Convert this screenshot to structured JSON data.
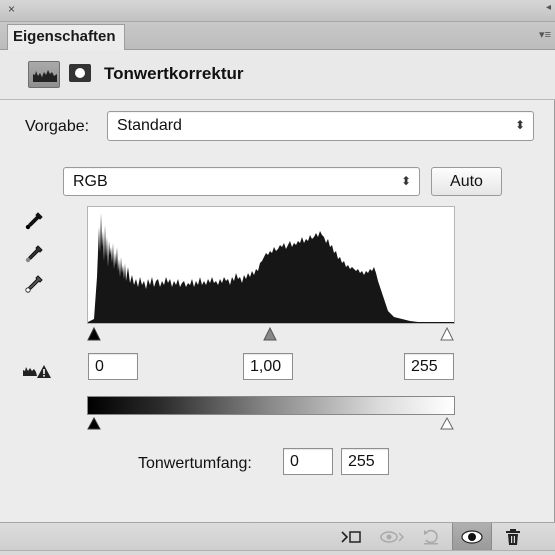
{
  "window": {
    "close_glyph": "×",
    "collapse_glyph": "◂"
  },
  "tab": {
    "label": "Eigenschaften",
    "menu_glyph": "▾≡"
  },
  "header": {
    "title": "Tonwertkorrektur",
    "adjustment_icon": "levels-histogram-icon",
    "mask_icon": "layer-mask-icon"
  },
  "preset": {
    "label": "Vorgabe:",
    "value": "Standard",
    "arrows": "⬍"
  },
  "channel": {
    "value": "RGB",
    "arrows": "⬍"
  },
  "auto_button": {
    "label": "Auto"
  },
  "eyedroppers": [
    "black-point-eyedropper-icon",
    "gray-point-eyedropper-icon",
    "white-point-eyedropper-icon"
  ],
  "input_levels": {
    "black": "0",
    "gamma": "1,00",
    "white": "255"
  },
  "output": {
    "label": "Tonwertumfang:",
    "black": "0",
    "white": "255"
  },
  "toolbar": {
    "clip_icon": "clip-to-layer-icon",
    "previous_icon": "view-previous-state-icon",
    "reset_icon": "reset-adjustments-icon",
    "visibility_icon": "eye-icon",
    "delete_icon": "trash-icon"
  },
  "colors": {
    "panel_bg": "#ececec",
    "histogram_fill": "#1a1a1a",
    "tab_bg": "#bcbcbc"
  }
}
